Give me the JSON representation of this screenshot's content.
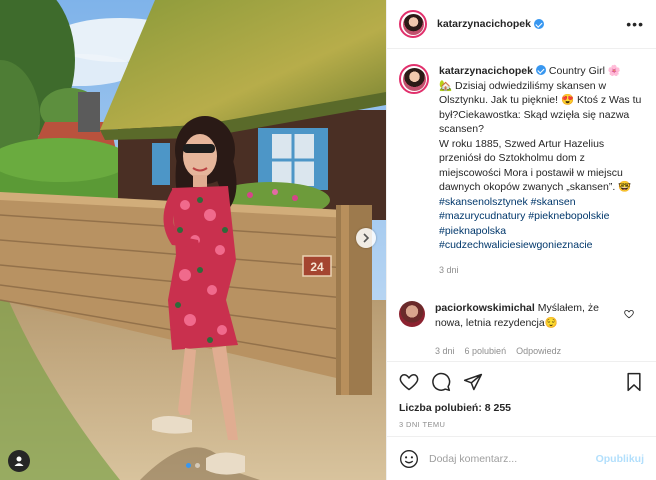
{
  "post": {
    "username": "katarzynacichopek",
    "verified": true,
    "caption_title": "Country Girl",
    "caption_title_emoji": "🌸",
    "caption_lines": [
      "🏡 Dzisiaj odwiedziliśmy skansen w Olsztynku. Jak tu pięknie! 😍 Ktoś z Was tu był?Ciekawostka: Skąd wzięła się nazwa scansen?",
      "W roku 1885, Szwed Artur Hazelius przeniósł do Sztokholmu dom z miejscowości Mora i postawił w miejscu dawnych okopów zwanych „skansen”. 🤓"
    ],
    "hashtags": [
      "#skansenolsztynek",
      "#skansen",
      "#mazurycudnatury",
      "#pieknebopolskie",
      "#pieknapolska",
      "#cudzechwaliciesiewgonieznacie"
    ],
    "caption_age": "3 dni"
  },
  "comment": {
    "username": "paciorkowskimichal",
    "text": "Myślałem, że nowa, letnia rezydencja😌",
    "age": "3 dni",
    "likes": "6 polubień",
    "reply": "Odpowiedz"
  },
  "stats": {
    "likes_label": "Liczba polubień: 8 255",
    "date": "3 DNI TEMU"
  },
  "composer": {
    "placeholder": "Dodaj komentarz...",
    "publish": "Opublikuj",
    "emoji_icon": "smiley-icon"
  },
  "photo": {
    "house_number": "24",
    "carousel_dots": 2,
    "active_dot": 1
  },
  "colors": {
    "accent": "#3897f0",
    "link": "#00376b",
    "muted": "#8e8e8e",
    "story_ring": "#e1306c"
  }
}
